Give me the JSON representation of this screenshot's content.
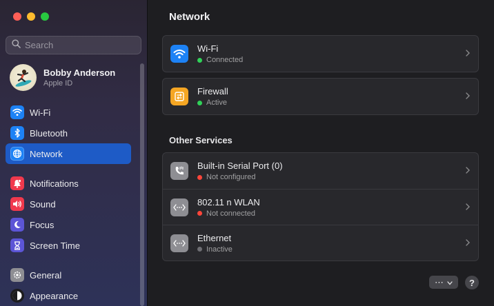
{
  "window": {
    "controls": [
      "close",
      "minimize",
      "zoom"
    ]
  },
  "search": {
    "placeholder": "Search",
    "value": ""
  },
  "account": {
    "name": "Bobby Anderson",
    "subtitle": "Apple ID"
  },
  "sidebar": {
    "groups": [
      [
        {
          "label": "Wi-Fi",
          "icon": "wifi-icon",
          "color": "#1d82f5"
        },
        {
          "label": "Bluetooth",
          "icon": "bluetooth-icon",
          "color": "#1d82f5"
        },
        {
          "label": "Network",
          "icon": "globe-icon",
          "color": "#1d82f5",
          "active": true
        }
      ],
      [
        {
          "label": "Notifications",
          "icon": "bell-icon",
          "color": "#f0394d"
        },
        {
          "label": "Sound",
          "icon": "speaker-icon",
          "color": "#f0394d"
        },
        {
          "label": "Focus",
          "icon": "moon-icon",
          "color": "#5c55d6"
        },
        {
          "label": "Screen Time",
          "icon": "hourglass-icon",
          "color": "#5c55d6"
        }
      ],
      [
        {
          "label": "General",
          "icon": "gear-icon",
          "color": "#8e8e93"
        },
        {
          "label": "Appearance",
          "icon": "appearance-icon",
          "color": "#1c1c1e"
        }
      ]
    ]
  },
  "main": {
    "title": "Network",
    "primary": [
      {
        "title": "Wi-Fi",
        "status": "Connected",
        "status_color": "#30d158",
        "icon": "wifi-icon",
        "icon_color": "#1d82f5"
      },
      {
        "title": "Firewall",
        "status": "Active",
        "status_color": "#30d158",
        "icon": "firewall-icon",
        "icon_color": "#f5a623"
      }
    ],
    "other_title": "Other Services",
    "other": [
      {
        "title": "Built-in Serial Port (0)",
        "status": "Not configured",
        "status_color": "#ff453a",
        "icon": "phone-icon",
        "icon_color": "#8e8e93"
      },
      {
        "title": "802.11 n WLAN",
        "status": "Not connected",
        "status_color": "#ff453a",
        "icon": "network-interface-icon",
        "icon_color": "#8e8e93"
      },
      {
        "title": "Ethernet",
        "status": "Inactive",
        "status_color": "#6e6e73",
        "icon": "network-interface-icon",
        "icon_color": "#8e8e93"
      }
    ],
    "more_button": "⋯",
    "help_button": "?"
  }
}
